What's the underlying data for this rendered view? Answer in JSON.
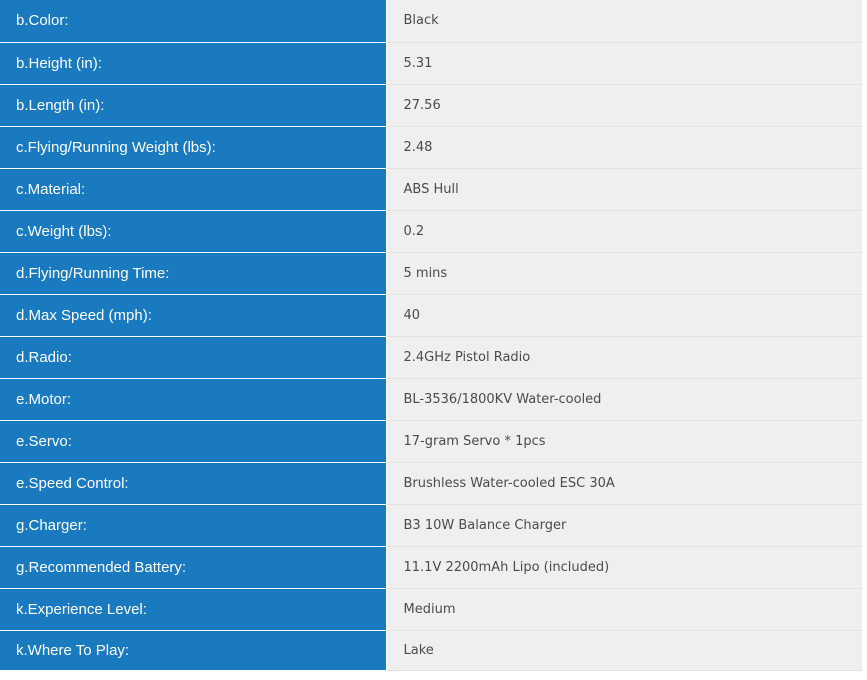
{
  "specs": {
    "rows": [
      {
        "label": "b.Color:",
        "value": "Black"
      },
      {
        "label": "b.Height (in):",
        "value": "5.31"
      },
      {
        "label": "b.Length (in):",
        "value": "27.56"
      },
      {
        "label": "c.Flying/Running Weight (lbs):",
        "value": "2.48"
      },
      {
        "label": "c.Material:",
        "value": "ABS Hull"
      },
      {
        "label": "c.Weight (lbs):",
        "value": "0.2"
      },
      {
        "label": "d.Flying/Running Time:",
        "value": "5 mins"
      },
      {
        "label": "d.Max Speed (mph):",
        "value": "40"
      },
      {
        "label": "d.Radio:",
        "value": "2.4GHz Pistol Radio"
      },
      {
        "label": "e.Motor:",
        "value": "BL-3536/1800KV Water-cooled"
      },
      {
        "label": "e.Servo:",
        "value": "17-gram Servo * 1pcs"
      },
      {
        "label": "e.Speed Control:",
        "value": "Brushless Water-cooled ESC 30A"
      },
      {
        "label": "g.Charger:",
        "value": "B3 10W Balance Charger"
      },
      {
        "label": "g.Recommended Battery:",
        "value": "11.1V 2200mAh Lipo (included)"
      },
      {
        "label": "k.Experience Level:",
        "value": "Medium"
      },
      {
        "label": "k.Where To Play:",
        "value": "Lake"
      }
    ]
  },
  "colors": {
    "label_background": "#1a7ac0",
    "value_background": "#efefef"
  }
}
